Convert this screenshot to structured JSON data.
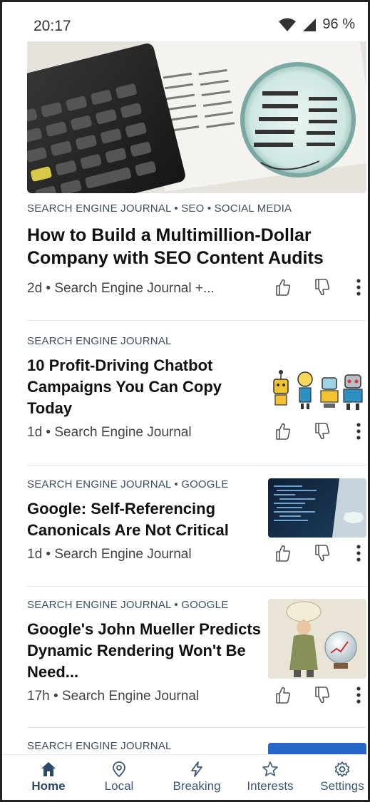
{
  "status_bar": {
    "time": "20:17",
    "battery": "96 %"
  },
  "articles": [
    {
      "tags": "SEARCH ENGINE JOURNAL • SEO • SOCIAL MEDIA",
      "title": "How to Build a Multimillion-Dollar Company with SEO Content Audits",
      "meta": "2d • Search Engine Journal +...",
      "image": "calculator-magnifier-image"
    },
    {
      "tags": "SEARCH ENGINE JOURNAL",
      "title": "10 Profit-Driving Chatbot Campaigns You Can Copy Today",
      "meta": "1d • Search Engine Journal",
      "image": "chatbot-robots-image"
    },
    {
      "tags": "SEARCH ENGINE JOURNAL • GOOGLE",
      "title": "Google: Self-Referencing Canonicals Are Not Critical",
      "meta": "1d • Search Engine Journal",
      "image": "laptop-code-image"
    },
    {
      "tags": "SEARCH ENGINE JOURNAL • GOOGLE",
      "title": "Google's John Mueller Predicts Dynamic Rendering Won't Be Need...",
      "meta": "17h • Search Engine Journal",
      "image": "fortune-teller-crystal-ball-image"
    },
    {
      "tags": "SEARCH ENGINE JOURNAL",
      "image": "blue-abstract-image"
    }
  ],
  "bottom_nav": [
    {
      "label": "Home",
      "icon": "home-icon",
      "active": true
    },
    {
      "label": "Local",
      "icon": "location-pin-icon"
    },
    {
      "label": "Breaking",
      "icon": "lightning-icon"
    },
    {
      "label": "Interests",
      "icon": "star-icon"
    },
    {
      "label": "Settings",
      "icon": "gear-icon"
    }
  ],
  "colors": {
    "accent": "#2c4a6b",
    "tag": "#3c4f63",
    "nav": "#3c5878"
  }
}
